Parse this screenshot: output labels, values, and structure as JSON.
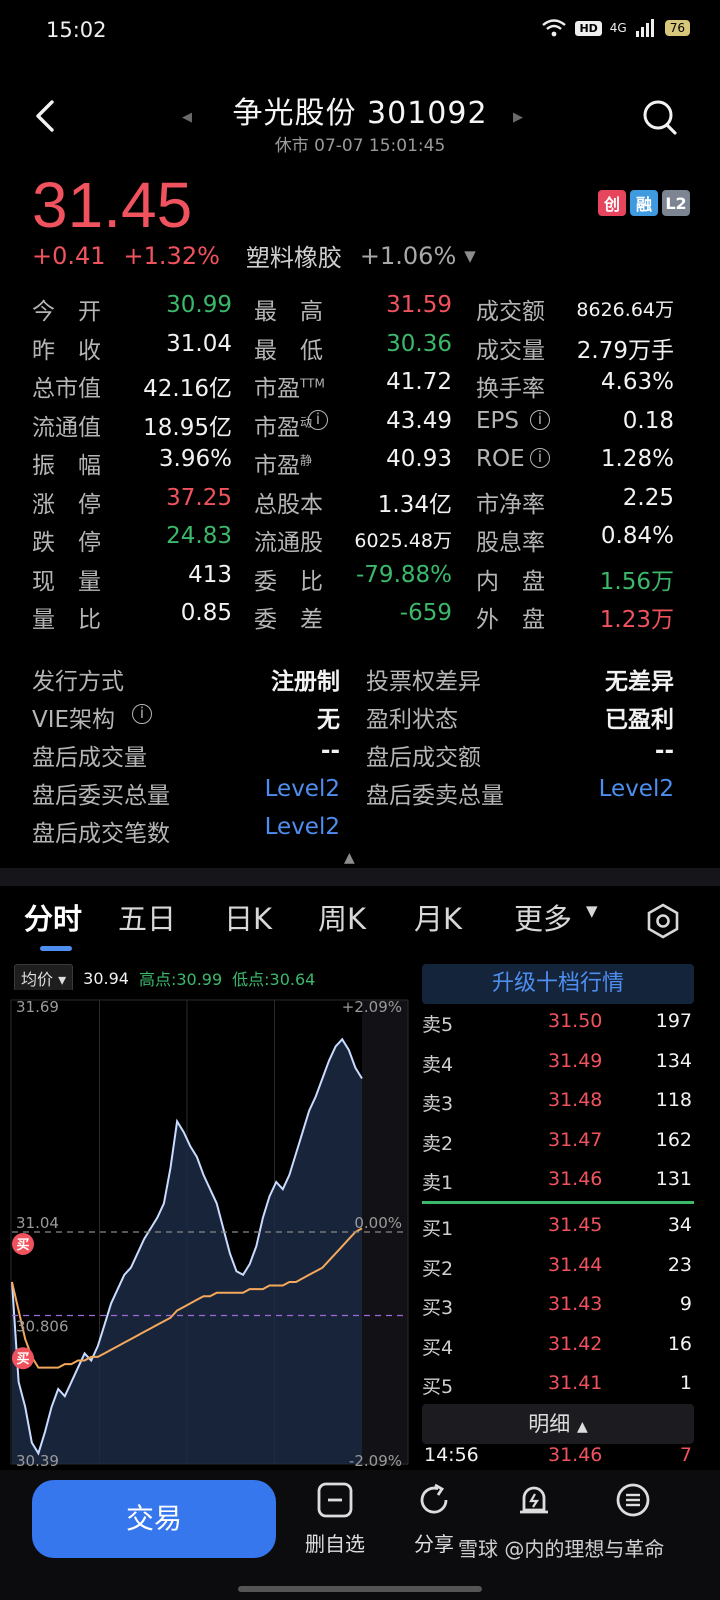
{
  "status_bar": {
    "time": "15:02",
    "hd": "HD",
    "network": "4G",
    "battery": "76"
  },
  "header": {
    "title": "争光股份 301092",
    "subtitle": "休市  07-07 15:01:45"
  },
  "price": {
    "last": "31.45",
    "change": "+0.41",
    "change_pct": "+1.32%",
    "sector": "塑料橡胶",
    "sector_change": "+1.06%",
    "badges": [
      {
        "text": "创",
        "color": "#e6455d"
      },
      {
        "text": "融",
        "color": "#3f9adf"
      },
      {
        "text": "L2",
        "color": "#7c8591"
      }
    ]
  },
  "quote": {
    "rows": [
      [
        {
          "l": "今　开",
          "v": "30.99",
          "c": "green"
        },
        {
          "l": "最　高",
          "v": "31.59",
          "c": "red"
        },
        {
          "l": "成交额",
          "v": "8626.64万",
          "c": "white"
        }
      ],
      [
        {
          "l": "昨　收",
          "v": "31.04",
          "c": "white"
        },
        {
          "l": "最　低",
          "v": "30.36",
          "c": "green"
        },
        {
          "l": "成交量",
          "v": "2.79万手",
          "c": "white"
        }
      ],
      [
        {
          "l": "总市值",
          "v": "42.16亿",
          "c": "white"
        },
        {
          "l": "市盈TTM",
          "v": "41.72",
          "c": "white"
        },
        {
          "l": "换手率",
          "v": "4.63%",
          "c": "white"
        }
      ],
      [
        {
          "l": "流通值",
          "v": "18.95亿",
          "c": "white"
        },
        {
          "l": "市盈动",
          "v": "43.49",
          "c": "white"
        },
        {
          "l": "EPS",
          "v": "0.18",
          "c": "white"
        }
      ],
      [
        {
          "l": "振　幅",
          "v": "3.96%",
          "c": "white"
        },
        {
          "l": "市盈静",
          "v": "40.93",
          "c": "white"
        },
        {
          "l": "ROE",
          "v": "1.28%",
          "c": "white"
        }
      ],
      [
        {
          "l": "涨　停",
          "v": "37.25",
          "c": "red"
        },
        {
          "l": "总股本",
          "v": "1.34亿",
          "c": "white"
        },
        {
          "l": "市净率",
          "v": "2.25",
          "c": "white"
        }
      ],
      [
        {
          "l": "跌　停",
          "v": "24.83",
          "c": "green"
        },
        {
          "l": "流通股",
          "v": "6025.48万",
          "c": "white"
        },
        {
          "l": "股息率",
          "v": "0.84%",
          "c": "white"
        }
      ],
      [
        {
          "l": "现　量",
          "v": "413",
          "c": "white"
        },
        {
          "l": "委　比",
          "v": "-79.88%",
          "c": "green"
        },
        {
          "l": "内　盘",
          "v": "1.56万",
          "c": "green"
        }
      ],
      [
        {
          "l": "量　比",
          "v": "0.85",
          "c": "white"
        },
        {
          "l": "委　差",
          "v": "-659",
          "c": "green"
        },
        {
          "l": "外　盘",
          "v": "1.23万",
          "c": "red"
        }
      ]
    ]
  },
  "profile": {
    "rows": [
      [
        {
          "l": "发行方式",
          "v": "注册制",
          "c": "white"
        },
        {
          "l": "投票权差异",
          "v": "无差异",
          "c": "white"
        }
      ],
      [
        {
          "l": "VIE架构",
          "v": "无",
          "c": "white"
        },
        {
          "l": "盈利状态",
          "v": "已盈利",
          "c": "white"
        }
      ],
      [
        {
          "l": "盘后成交量",
          "v": "--",
          "c": "white"
        },
        {
          "l": "盘后成交额",
          "v": "--",
          "c": "white"
        }
      ],
      [
        {
          "l": "盘后委买总量",
          "v": "Level2",
          "c": "blue"
        },
        {
          "l": "盘后委卖总量",
          "v": "Level2",
          "c": "blue"
        }
      ],
      [
        {
          "l": "盘后成交笔数",
          "v": "Level2",
          "c": "blue"
        }
      ]
    ]
  },
  "tabs": [
    "分时",
    "五日",
    "日K",
    "周K",
    "月K",
    "更多"
  ],
  "chart_info": {
    "avg_label": "均价",
    "avg_value": "30.94",
    "high_text": "高点:30.99",
    "low_text": "低点:30.64"
  },
  "chart_data": {
    "type": "line",
    "y_labels": {
      "top": "31.69",
      "mid": "31.04",
      "avg": "30.806",
      "bottom": "30.39"
    },
    "pct_labels": {
      "top": "+2.09%",
      "mid": "0.00%",
      "bottom": "-2.09%"
    },
    "ylim": [
      30.39,
      31.69
    ],
    "prev_close": 31.04,
    "avg_ref": 30.806,
    "price_series": [
      30.9,
      30.62,
      30.55,
      30.45,
      30.42,
      30.48,
      30.55,
      30.6,
      30.58,
      30.62,
      30.66,
      30.7,
      30.68,
      30.72,
      30.78,
      30.84,
      30.88,
      30.92,
      30.94,
      30.98,
      31.02,
      31.05,
      31.08,
      31.12,
      31.22,
      31.35,
      31.32,
      31.28,
      31.25,
      31.2,
      31.16,
      31.12,
      31.05,
      30.98,
      30.93,
      30.92,
      30.95,
      31.0,
      31.08,
      31.14,
      31.18,
      31.16,
      31.2,
      31.26,
      31.32,
      31.38,
      31.42,
      31.47,
      31.52,
      31.56,
      31.58,
      31.55,
      31.5,
      31.47
    ],
    "avg_series": [
      30.9,
      30.82,
      30.74,
      30.69,
      30.66,
      30.66,
      30.66,
      30.66,
      30.67,
      30.67,
      30.68,
      30.68,
      30.69,
      30.69,
      30.7,
      30.71,
      30.72,
      30.73,
      30.74,
      30.75,
      30.76,
      30.77,
      30.78,
      30.79,
      30.8,
      30.82,
      30.83,
      30.84,
      30.85,
      30.86,
      30.86,
      30.87,
      30.87,
      30.87,
      30.87,
      30.87,
      30.88,
      30.88,
      30.88,
      30.89,
      30.89,
      30.89,
      30.9,
      30.9,
      30.91,
      30.92,
      30.93,
      30.94,
      30.96,
      30.98,
      31.0,
      31.02,
      31.04,
      31.05
    ],
    "buy_markers": [
      {
        "label": "买",
        "value": 31.04,
        "index": 0
      },
      {
        "label": "买",
        "value": 30.72,
        "index": 0
      }
    ]
  },
  "order_book": {
    "upgrade_label": "升级十档行情",
    "asks": [
      {
        "l": "卖5",
        "p": "31.50",
        "v": "197"
      },
      {
        "l": "卖4",
        "p": "31.49",
        "v": "134"
      },
      {
        "l": "卖3",
        "p": "31.48",
        "v": "118"
      },
      {
        "l": "卖2",
        "p": "31.47",
        "v": "162"
      },
      {
        "l": "卖1",
        "p": "31.46",
        "v": "131"
      }
    ],
    "bids": [
      {
        "l": "买1",
        "p": "31.45",
        "v": "34"
      },
      {
        "l": "买2",
        "p": "31.44",
        "v": "23"
      },
      {
        "l": "买3",
        "p": "31.43",
        "v": "9"
      },
      {
        "l": "买4",
        "p": "31.42",
        "v": "16"
      },
      {
        "l": "买5",
        "p": "31.41",
        "v": "1"
      }
    ],
    "detail_label": "明细",
    "last_trade": {
      "time": "14:56",
      "price": "31.46",
      "vol": "7"
    }
  },
  "bottom": {
    "trade": "交易",
    "items": [
      {
        "icon": "minus-square-icon",
        "label": "删自选"
      },
      {
        "icon": "share-icon",
        "label": "分享"
      },
      {
        "icon": "alert-bell-icon",
        "label": ""
      },
      {
        "icon": "menu-list-icon",
        "label": ""
      }
    ],
    "watermark": "雪球 @内的理想与革命"
  }
}
